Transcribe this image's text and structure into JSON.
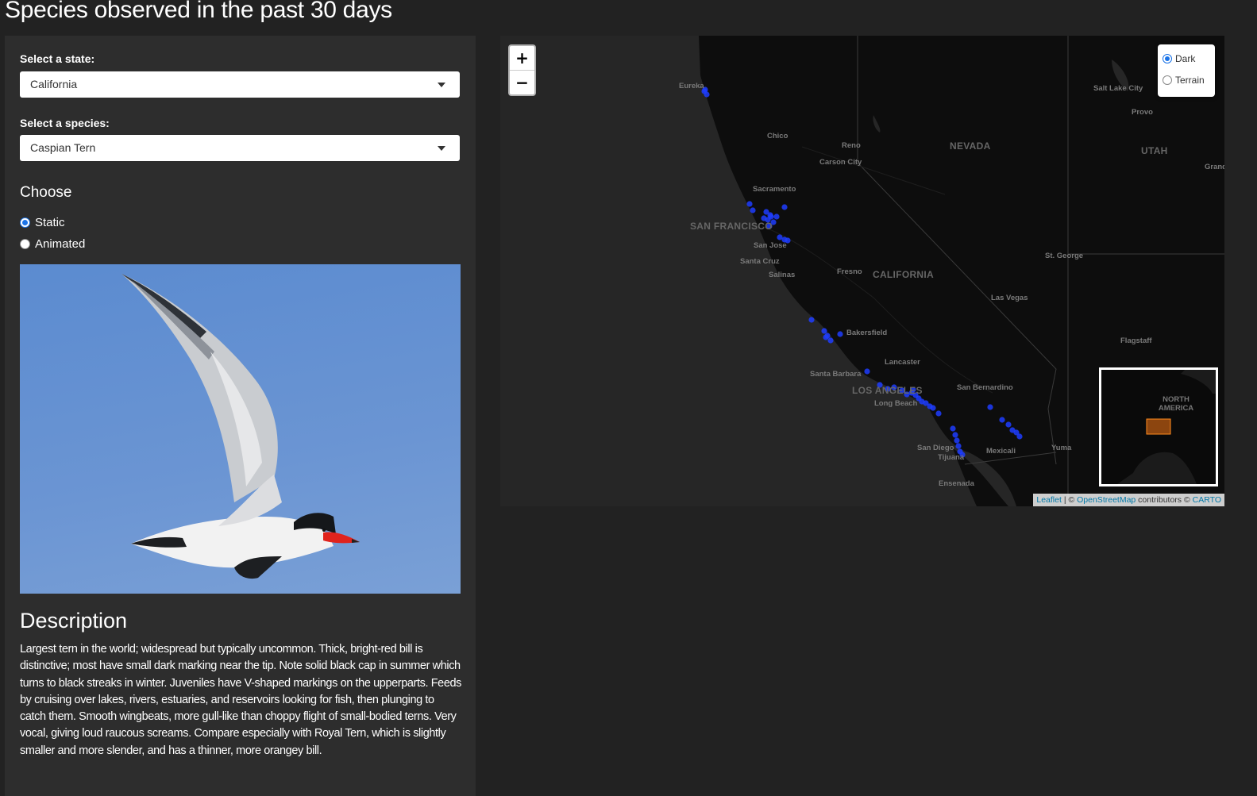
{
  "page": {
    "title": "Species observed in the past 30 days"
  },
  "sidebar": {
    "state_label": "Select a state:",
    "state_value": "California",
    "species_label": "Select a species:",
    "species_value": "Caspian Tern",
    "choose_heading": "Choose",
    "mode_options": [
      {
        "label": "Static",
        "checked": true
      },
      {
        "label": "Animated",
        "checked": false
      }
    ],
    "description_heading": "Description",
    "description_text": "Largest tern in the world; widespread but typically uncommon. Thick, bright-red bill is distinctive; most have small dark marking near the tip. Note solid black cap in summer which turns to black streaks in winter. Juveniles have V-shaped markings on the upperparts. Feeds by cruising over lakes, rivers, estuaries, and reservoirs looking for fish, then plunging to catch them. Smooth wingbeats, more gull-like than choppy flight of small-bodied terns. Very vocal, giving loud raucous screams. Compare especially with Royal Tern, which is slightly smaller and more slender, and has a thinner, more orangey bill."
  },
  "map": {
    "zoom_in": "+",
    "zoom_out": "−",
    "layers": [
      {
        "label": "Dark",
        "checked": true
      },
      {
        "label": "Terrain",
        "checked": false
      }
    ],
    "labels": {
      "eureka": "Eureka",
      "chico": "Chico",
      "reno": "Reno",
      "carson_city": "Carson City",
      "nevada": "NEVADA",
      "utah": "UTAH",
      "salt_lake_city": "Salt Lake City",
      "provo": "Provo",
      "sacramento": "Sacramento",
      "san_francisco": "SAN FRANCISCO",
      "san_jose": "San Jose",
      "santa_cruz": "Santa Cruz",
      "salinas": "Salinas",
      "fresno": "Fresno",
      "california": "CALIFORNIA",
      "st_george": "St. George",
      "las_vegas": "Las Vegas",
      "bakersfield": "Bakersfield",
      "flagstaff": "Flagstaff",
      "lancaster": "Lancaster",
      "santa_barbara": "Santa Barbara",
      "los_angeles": "LOS ANGELES",
      "san_bernardino": "San Bernardino",
      "long_beach": "Long Beach",
      "san_diego": "San Diego",
      "tijuana": "Tijuana",
      "mexicali": "Mexicali",
      "yuma": "Yuma",
      "ensenada": "Ensenada",
      "grand": "Grand"
    },
    "minimap_label": "NORTH AMERICA",
    "attribution": {
      "leaflet": "Leaflet",
      "sep": " | © ",
      "osm": "OpenStreetMap",
      "contrib": " contributors © ",
      "carto": "CARTO"
    },
    "observation_color": "#1f3dff"
  }
}
